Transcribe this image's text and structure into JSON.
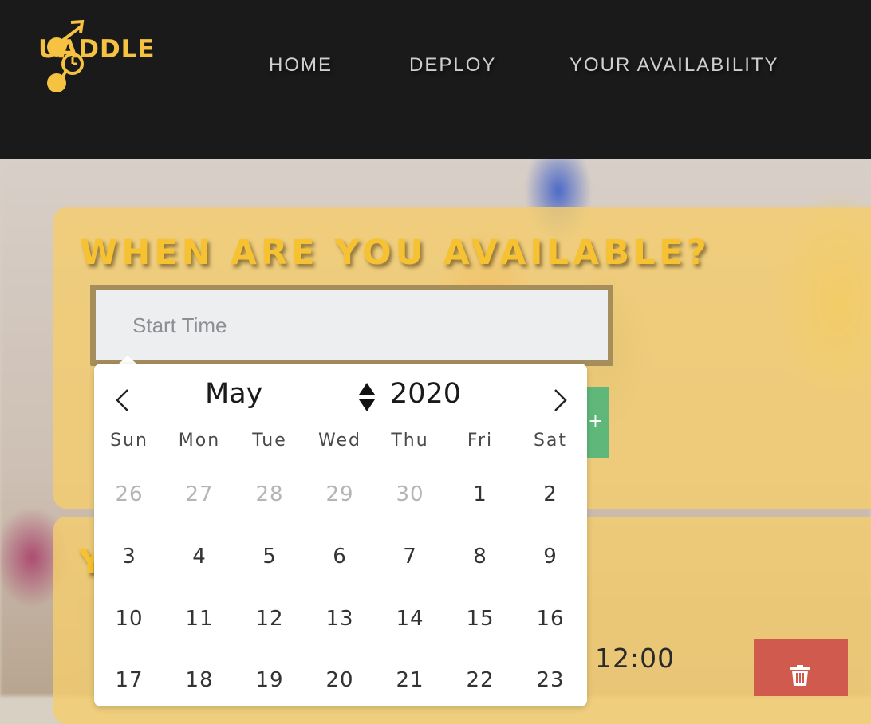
{
  "brand": {
    "logo_text": "UADDLE"
  },
  "nav": {
    "home": "HOME",
    "deploy": "DEPLOY",
    "availability": "YOUR AVAILABILITY"
  },
  "availability_panel": {
    "title": "WHEN ARE YOU AVAILABLE?",
    "start_time_placeholder": "Start Time",
    "add_button_label": "+"
  },
  "list_panel": {
    "title_partial": "Y",
    "row_time": "12:00"
  },
  "calendar": {
    "month": "May",
    "year": "2020",
    "weekdays": [
      "Sun",
      "Mon",
      "Tue",
      "Wed",
      "Thu",
      "Fri",
      "Sat"
    ],
    "weeks": [
      [
        "26",
        "27",
        "28",
        "29",
        "30",
        "1",
        "2"
      ],
      [
        "3",
        "4",
        "5",
        "6",
        "7",
        "8",
        "9"
      ],
      [
        "10",
        "11",
        "12",
        "13",
        "14",
        "15",
        "16"
      ],
      [
        "17",
        "18",
        "19",
        "20",
        "21",
        "22",
        "23"
      ]
    ]
  },
  "colors": {
    "header_bg": "#1a1a1a",
    "accent_yellow": "#f6c231",
    "add_green": "#5fb87a",
    "delete_red": "#cf5a4d"
  }
}
